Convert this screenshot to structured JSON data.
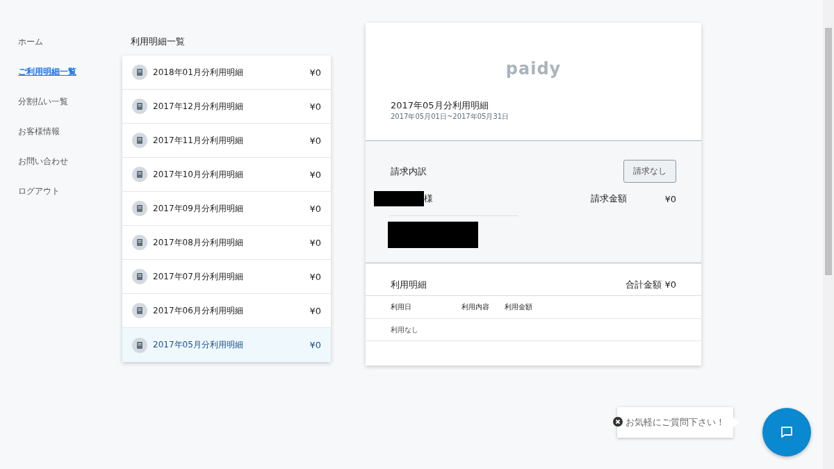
{
  "nav": [
    {
      "label": "ホーム",
      "selected": false
    },
    {
      "label": "ご利用明細一覧",
      "selected": true
    },
    {
      "label": "分割払い一覧",
      "selected": false
    },
    {
      "label": "お客様情報",
      "selected": false
    },
    {
      "label": "お問い合わせ",
      "selected": false
    },
    {
      "label": "ログアウト",
      "selected": false
    }
  ],
  "statements": {
    "title": "利用明細一覧",
    "items": [
      {
        "label": "2018年01月分利用明細",
        "amount": "¥0",
        "selected": false
      },
      {
        "label": "2017年12月分利用明細",
        "amount": "¥0",
        "selected": false
      },
      {
        "label": "2017年11月分利用明細",
        "amount": "¥0",
        "selected": false
      },
      {
        "label": "2017年10月分利用明細",
        "amount": "¥0",
        "selected": false
      },
      {
        "label": "2017年09月分利用明細",
        "amount": "¥0",
        "selected": false
      },
      {
        "label": "2017年08月分利用明細",
        "amount": "¥0",
        "selected": false
      },
      {
        "label": "2017年07月分利用明細",
        "amount": "¥0",
        "selected": false
      },
      {
        "label": "2017年06月分利用明細",
        "amount": "¥0",
        "selected": false
      },
      {
        "label": "2017年05月分利用明細",
        "amount": "¥0",
        "selected": true
      }
    ]
  },
  "detail": {
    "logo": "paidy",
    "title": "2017年05月分利用明細",
    "period": "2017年05月01日~2017年05月31日",
    "billing": {
      "title": "請求内訳",
      "status_button": "請求なし",
      "name_suffix": "様",
      "amount_label": "請求金額",
      "amount": "¥0"
    },
    "usage": {
      "title": "利用明細",
      "total": "合計金額 ¥0",
      "columns": [
        "利用日",
        "利用内容",
        "利用金額"
      ],
      "empty": "利用なし"
    }
  },
  "chat": {
    "bubble": "お気軽にご質問下さい！"
  }
}
